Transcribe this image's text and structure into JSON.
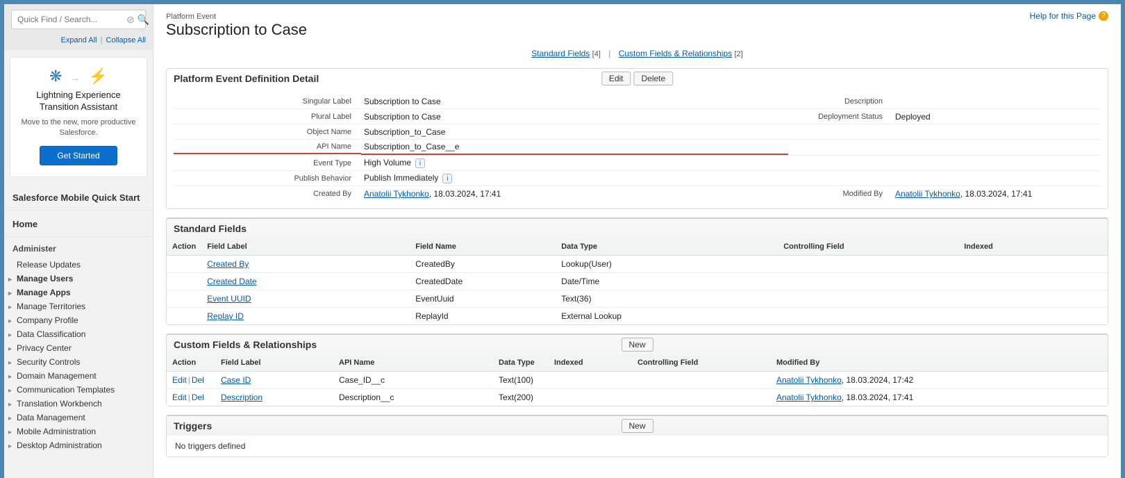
{
  "sidebar": {
    "search_placeholder": "Quick Find / Search...",
    "expand_all": "Expand All",
    "collapse_all": "Collapse All",
    "promo": {
      "title": "Lightning Experience Transition Assistant",
      "desc": "Move to the new, more productive Salesforce.",
      "btn": "Get Started"
    },
    "quick_start": "Salesforce Mobile Quick Start",
    "home": "Home",
    "administer": "Administer",
    "items": [
      {
        "label": "Release Updates",
        "tri": false,
        "bold": false
      },
      {
        "label": "Manage Users",
        "tri": true,
        "bold": true
      },
      {
        "label": "Manage Apps",
        "tri": true,
        "bold": true
      },
      {
        "label": "Manage Territories",
        "tri": true,
        "bold": false
      },
      {
        "label": "Company Profile",
        "tri": true,
        "bold": false
      },
      {
        "label": "Data Classification",
        "tri": true,
        "bold": false
      },
      {
        "label": "Privacy Center",
        "tri": true,
        "bold": false
      },
      {
        "label": "Security Controls",
        "tri": true,
        "bold": false
      },
      {
        "label": "Domain Management",
        "tri": true,
        "bold": false
      },
      {
        "label": "Communication Templates",
        "tri": true,
        "bold": false
      },
      {
        "label": "Translation Workbench",
        "tri": true,
        "bold": false
      },
      {
        "label": "Data Management",
        "tri": true,
        "bold": false
      },
      {
        "label": "Mobile Administration",
        "tri": true,
        "bold": false
      },
      {
        "label": "Desktop Administration",
        "tri": true,
        "bold": false
      }
    ]
  },
  "header": {
    "page_type": "Platform Event",
    "title": "Subscription to Case",
    "help": "Help for this Page"
  },
  "anchors": {
    "std": "Standard Fields",
    "std_count": "[4]",
    "cust": "Custom Fields & Relationships",
    "cust_count": "[2]"
  },
  "detail": {
    "heading": "Platform Event Definition Detail",
    "btn_edit": "Edit",
    "btn_delete": "Delete",
    "lbl_singular": "Singular Label",
    "val_singular": "Subscription to Case",
    "lbl_plural": "Plural Label",
    "val_plural": "Subscription to Case",
    "lbl_object": "Object Name",
    "val_object": "Subscription_to_Case",
    "lbl_api": "API Name",
    "val_api": "Subscription_to_Case__e",
    "lbl_event": "Event Type",
    "val_event": "High Volume",
    "lbl_publish": "Publish Behavior",
    "val_publish": "Publish Immediately",
    "lbl_desc": "Description",
    "val_desc": "",
    "lbl_deploy": "Deployment Status",
    "val_deploy": "Deployed",
    "lbl_created": "Created By",
    "created_name": "Anatolii Tykhonko",
    "created_stamp": ", 18.03.2024, 17:41",
    "lbl_modified": "Modified By",
    "modified_name": "Anatolii Tykhonko",
    "modified_stamp": ", 18.03.2024, 17:41"
  },
  "std_fields": {
    "heading": "Standard Fields",
    "cols": {
      "action": "Action",
      "label": "Field Label",
      "name": "Field Name",
      "dtype": "Data Type",
      "ctrl": "Controlling Field",
      "idx": "Indexed"
    },
    "rows": [
      {
        "label": "Created By",
        "name": "CreatedBy",
        "dtype": "Lookup(User)"
      },
      {
        "label": "Created Date",
        "name": "CreatedDate",
        "dtype": "Date/Time"
      },
      {
        "label": "Event UUID",
        "name": "EventUuid",
        "dtype": "Text(36)"
      },
      {
        "label": "Replay ID",
        "name": "ReplayId",
        "dtype": "External Lookup"
      }
    ]
  },
  "cust_fields": {
    "heading": "Custom Fields & Relationships",
    "btn_new": "New",
    "cols": {
      "action": "Action",
      "label": "Field Label",
      "api": "API Name",
      "dtype": "Data Type",
      "idx": "Indexed",
      "ctrl": "Controlling Field",
      "mod": "Modified By"
    },
    "edit": "Edit",
    "del": "Del",
    "rows": [
      {
        "label": "Case ID",
        "api": "Case_ID__c",
        "dtype": "Text(100)",
        "mod_name": "Anatolii Tykhonko",
        "mod_stamp": ", 18.03.2024, 17:42"
      },
      {
        "label": "Description",
        "api": "Description__c",
        "dtype": "Text(200)",
        "mod_name": "Anatolii Tykhonko",
        "mod_stamp": ", 18.03.2024, 17:41"
      }
    ]
  },
  "triggers": {
    "heading": "Triggers",
    "btn_new": "New",
    "empty": "No triggers defined"
  }
}
